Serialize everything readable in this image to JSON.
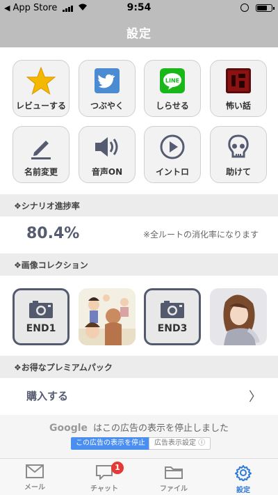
{
  "status_bar": {
    "back_label": "App Store",
    "time": "9:54"
  },
  "nav": {
    "title": "設定"
  },
  "actions": [
    {
      "label": "レビューする",
      "icon": "star-icon"
    },
    {
      "label": "つぶやく",
      "icon": "twitter-icon"
    },
    {
      "label": "しらせる",
      "icon": "line-icon"
    },
    {
      "label": "怖い話",
      "icon": "horror-icon"
    },
    {
      "label": "名前変更",
      "icon": "pen-icon"
    },
    {
      "label": "音声ON",
      "icon": "speaker-icon"
    },
    {
      "label": "イントロ",
      "icon": "play-icon"
    },
    {
      "label": "助けて",
      "icon": "skull-icon"
    }
  ],
  "line_icon_text": "LINE",
  "progress": {
    "header": "❖シナリオ進捗率",
    "value": "80.4%",
    "note": "※全ルートの消化率になります"
  },
  "gallery": {
    "header": "❖画像コレクション",
    "items": [
      {
        "label": "END1",
        "locked": true
      },
      {
        "label": "",
        "locked": false
      },
      {
        "label": "END3",
        "locked": true
      },
      {
        "label": "",
        "locked": false
      }
    ]
  },
  "premium": {
    "header": "❖お得なプレミアムパック",
    "purchase_label": "購入する",
    "chevron": "〉"
  },
  "ad": {
    "google": "Google",
    "message": "はこの広告の表示を停止しました",
    "stop_button": "この広告の表示を停止",
    "settings_button": "広告表示設定 ⓘ"
  },
  "tabs": [
    {
      "label": "メール",
      "icon": "mail-icon",
      "active": false
    },
    {
      "label": "チャット",
      "icon": "chat-icon",
      "active": false,
      "badge": "1"
    },
    {
      "label": "ファイル",
      "icon": "folder-icon",
      "active": false
    },
    {
      "label": "設定",
      "icon": "gear-icon",
      "active": true
    }
  ],
  "colors": {
    "header_bg": "#bdbdbd",
    "accent": "#555b70",
    "tab_active": "#2f7ad6",
    "badge": "#e53935",
    "star": "#f5b800",
    "twitter": "#4b8bd1",
    "line": "#19b719"
  }
}
